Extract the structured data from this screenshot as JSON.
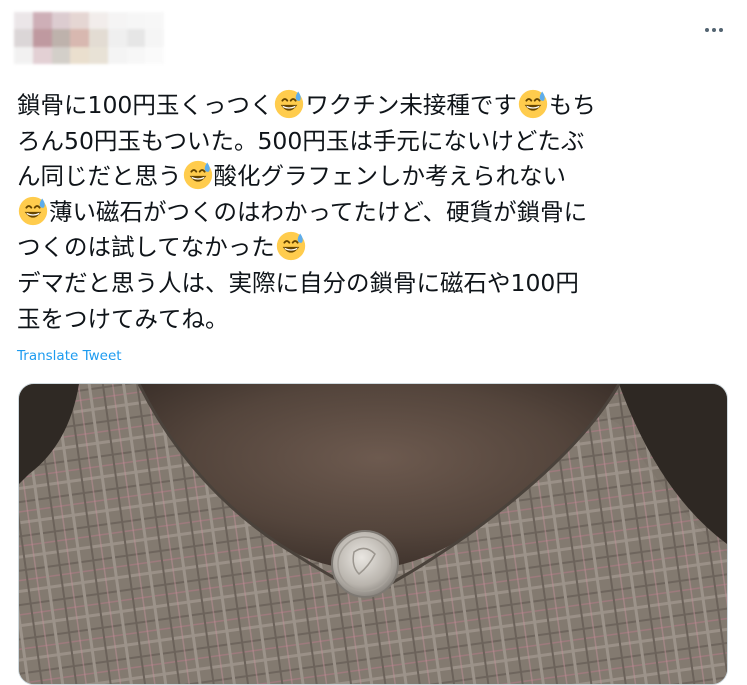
{
  "tweet": {
    "lines": [
      [
        "鎖骨に100円玉くっつく",
        "emoji",
        "ワクチン未接種です",
        "emoji",
        "もち"
      ],
      [
        "ろん50円玉もついた。500円玉は手元にないけどたぶ"
      ],
      [
        "ん同じだと思う",
        "emoji",
        "酸化グラフェンしか考えられない"
      ],
      [
        "emoji",
        "薄い磁石がつくのはわかってたけど、硬貨が鎖骨に"
      ],
      [
        "つくのは試してなかった",
        "emoji"
      ],
      [
        "デマだと思う人は、実際に自分の鎖骨に磁石や100円"
      ],
      [
        "玉をつけてみてね。"
      ]
    ],
    "translate_label": "Translate Tweet",
    "emoji_icon": "grinning-face-with-sweat-icon"
  },
  "colors": {
    "link_blue": "#1d9bf0",
    "text": "#0f1419",
    "muted": "#536471",
    "border": "#cfd9de"
  }
}
